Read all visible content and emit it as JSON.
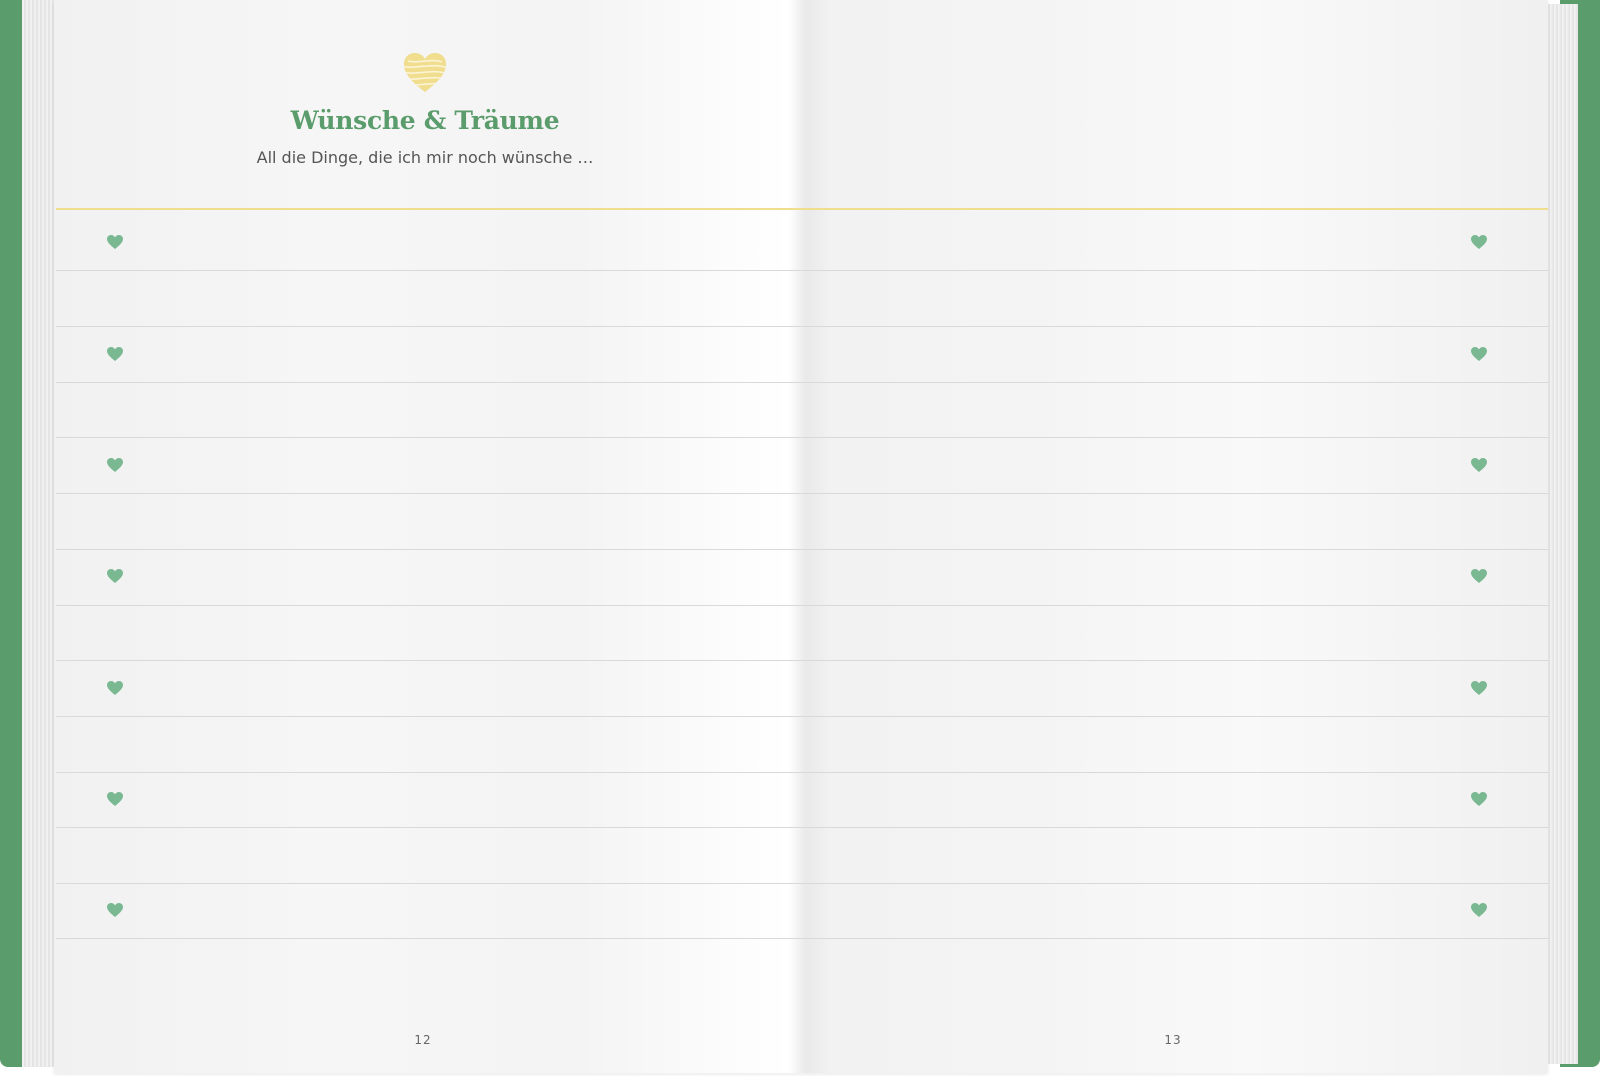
{
  "page": {
    "title": "Wünsche & Träume",
    "subtitle": "All die Dinge, die ich mir noch wünsche …",
    "page_left": "12",
    "page_right": "13"
  },
  "icons": {
    "title_heart": "striped-heart-icon",
    "bullet_heart": "heart-icon"
  },
  "colors": {
    "cover_green": "#5a9c6b",
    "title_green": "#5a9c6b",
    "bullet_heart": "#79b891",
    "title_heart": "#f0dd8e",
    "gold_rule": "#f0dd8e",
    "rule": "#d9d9d9"
  }
}
